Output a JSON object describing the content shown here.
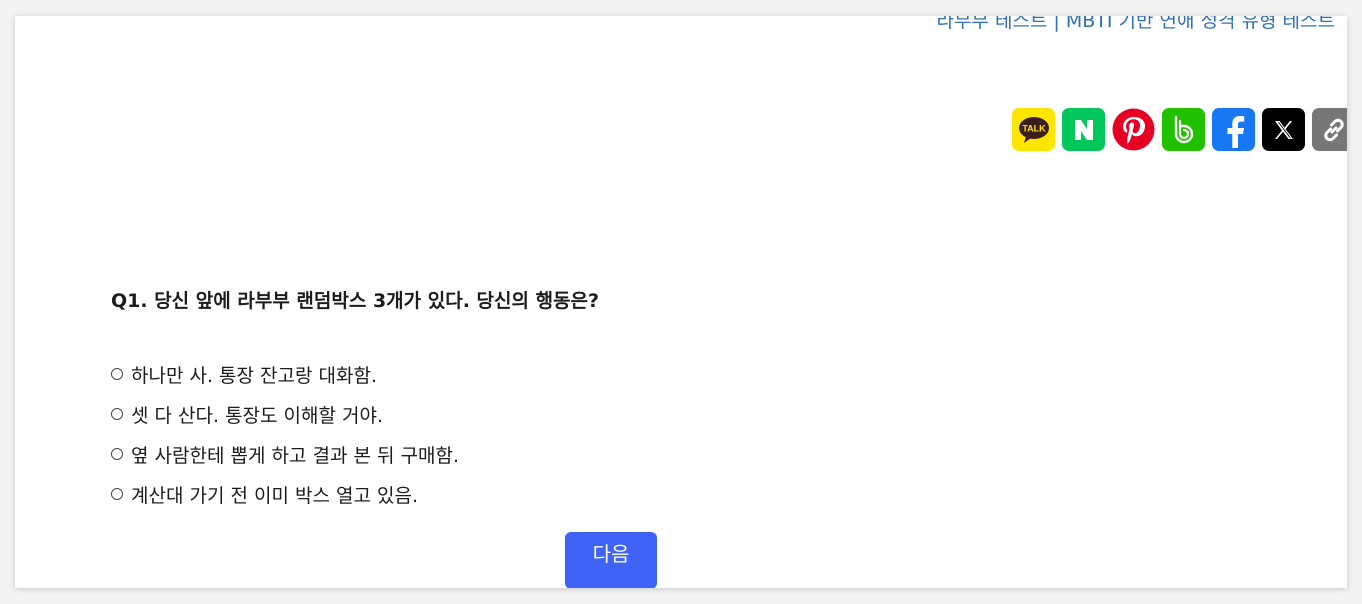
{
  "header": {
    "site_link": "라부부 테스트 | MBTI 기반 연애 성격 유형 테스트"
  },
  "share": {
    "buttons": [
      {
        "name": "kakaotalk",
        "label": "TALK",
        "color": "#FEE500"
      },
      {
        "name": "naver",
        "label": "N",
        "color": "#03C75A"
      },
      {
        "name": "pinterest",
        "label": "",
        "color": "#E60023"
      },
      {
        "name": "naver-band",
        "label": "b",
        "color": "#21C100"
      },
      {
        "name": "facebook",
        "label": "f",
        "color": "#1877F2"
      },
      {
        "name": "x",
        "label": "X",
        "color": "#000000"
      },
      {
        "name": "copy-link",
        "label": "",
        "color": "#777777"
      }
    ]
  },
  "quiz": {
    "question": "Q1. 당신 앞에 라부부 랜덤박스 3개가 있다. 당신의 행동은?",
    "options": [
      "하나만 사. 통장 잔고랑 대화함.",
      "셋 다 산다. 통장도 이해할 거야.",
      "옆 사람한테 뽑게 하고 결과 본 뒤 구매함.",
      "계산대 가기 전 이미 박스 열고 있음."
    ],
    "next_label": "다음"
  },
  "colors": {
    "accent": "#3f63f5",
    "link": "#2f6fb7"
  }
}
